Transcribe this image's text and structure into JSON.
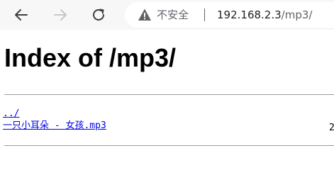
{
  "browser": {
    "security_label": "不安全",
    "url_host": "192.168.2.3",
    "url_path": "/mp3/"
  },
  "page": {
    "title": "Index of /mp3/",
    "entries": [
      {
        "name": "../"
      },
      {
        "name": "一只小耳朵 - 女孩.mp3"
      }
    ],
    "trailing_text": "2"
  }
}
